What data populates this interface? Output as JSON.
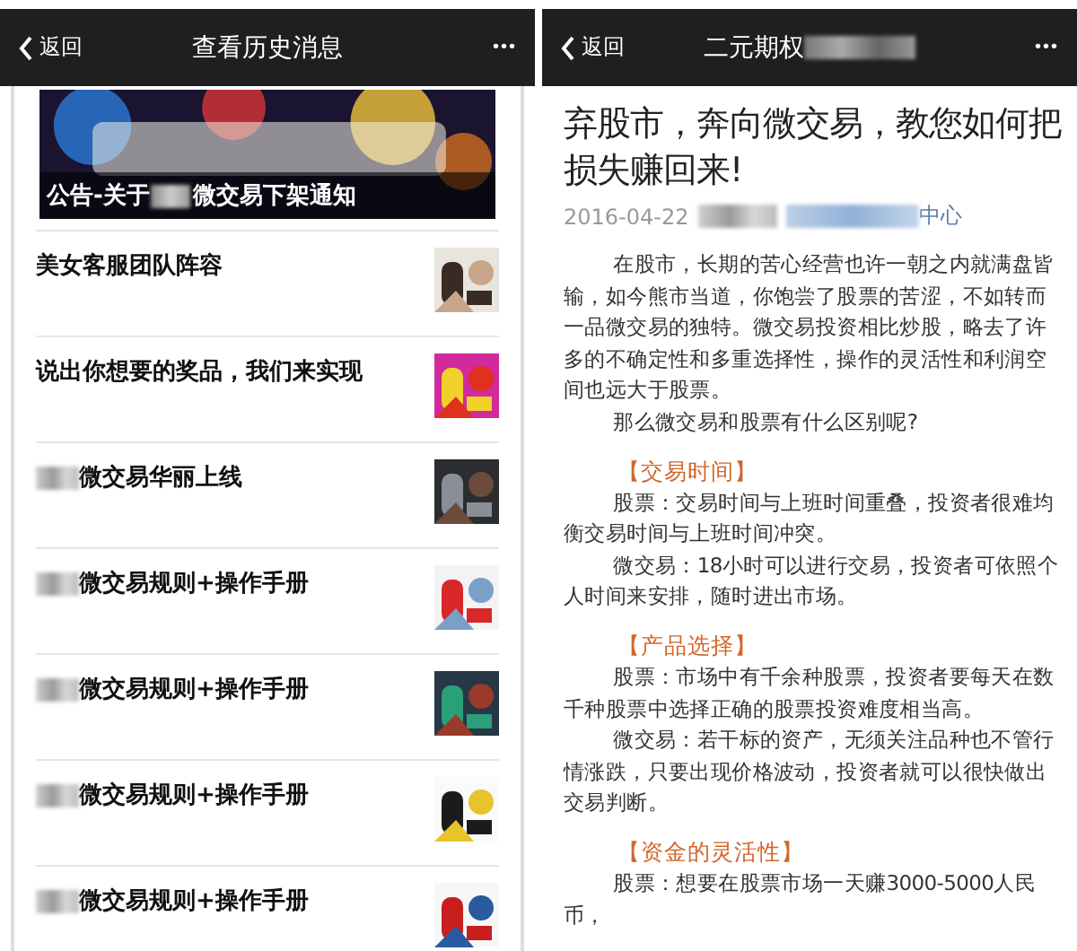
{
  "left_screen": {
    "nav": {
      "back": "返回",
      "title": "查看历史消息",
      "more": "•••"
    },
    "banner": {
      "caption_before": "公告-关于",
      "caption_after": "微交易下架通知"
    },
    "items": [
      {
        "title": "美女客服团队阵容",
        "redacted_prefix": false
      },
      {
        "title": "说出你想要的奖品，我们来实现",
        "redacted_prefix": false
      },
      {
        "title": "微交易华丽上线",
        "redacted_prefix": true
      },
      {
        "title": "微交易规则+操作手册",
        "redacted_prefix": true
      },
      {
        "title": "微交易规则+操作手册",
        "redacted_prefix": true
      },
      {
        "title": "微交易规则+操作手册",
        "redacted_prefix": true
      },
      {
        "title": "微交易规则+操作手册",
        "redacted_prefix": true
      }
    ]
  },
  "right_screen": {
    "nav": {
      "back": "返回",
      "title": "二元期权",
      "more": "•••"
    },
    "article": {
      "title": "弃股市，奔向微交易，教您如何把损失赚回来!",
      "date": "2016-04-22",
      "source_suffix": "中心",
      "blocks": [
        {
          "kind": "text",
          "text": "在股市，长期的苦心经营也许一朝之内就满盘皆输，如今熊市当道，你饱尝了股票的苦涩，不如转而一品微交易的独特。微交易投资相比炒股，略去了许多的不确定性和多重选择性，操作的灵活性和利润空间也远大于股票。"
        },
        {
          "kind": "text",
          "text": "那么微交易和股票有什么区别呢?"
        },
        {
          "kind": "heading",
          "text": "【交易时间】"
        },
        {
          "kind": "text",
          "text": "股票：交易时间与上班时间重叠，投资者很难均衡交易时间与上班时间冲突。"
        },
        {
          "kind": "text",
          "text": "微交易：18小时可以进行交易，投资者可依照个人时间来安排，随时进出市场。"
        },
        {
          "kind": "heading",
          "text": "【产品选择】"
        },
        {
          "kind": "text",
          "text": "股票：市场中有千余种股票，投资者要每天在数千种股票中选择正确的股票投资难度相当高。"
        },
        {
          "kind": "text",
          "text": "微交易：若干标的资产，无须关注品种也不管行情涨跌，只要出现价格波动，投资者就可以很快做出交易判断。"
        },
        {
          "kind": "heading",
          "text": "【资金的灵活性】"
        },
        {
          "kind": "text",
          "text": "股票：想要在股票市场一天赚3000-5000人民币，"
        }
      ]
    }
  }
}
